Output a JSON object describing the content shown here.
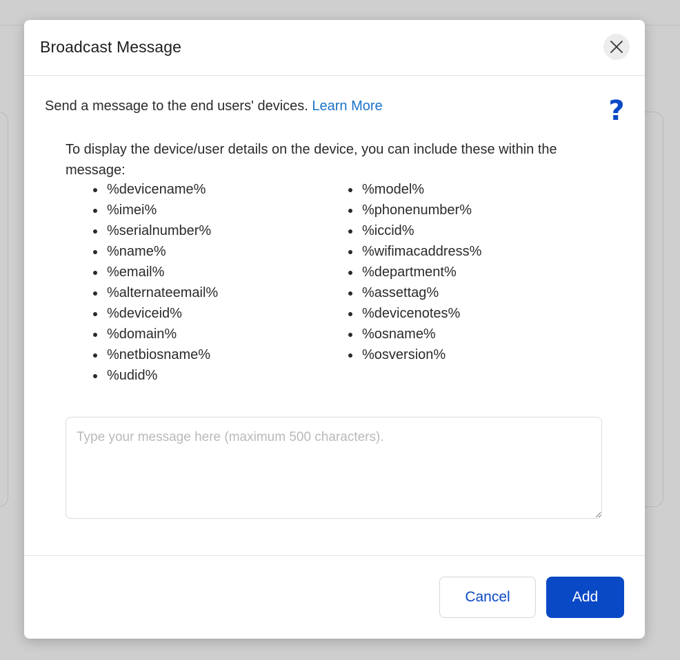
{
  "dialog": {
    "title": "Broadcast Message",
    "intro_text": "Send a message to the end users' devices.",
    "learn_more": "Learn More",
    "help_glyph": "?",
    "info_text": "To display the device/user details on the device, you can include these within the message:",
    "variables_col1": [
      "%devicename%",
      "%imei%",
      "%serialnumber%",
      "%name%",
      "%email%",
      "%alternateemail%",
      "%deviceid%",
      "%domain%",
      "%netbiosname%",
      "%udid%"
    ],
    "variables_col2": [
      "%model%",
      "%phonenumber%",
      "%iccid%",
      "%wifimacaddress%",
      "%department%",
      "%assettag%",
      "%devicenotes%",
      "%osname%",
      "%osversion%"
    ],
    "message_placeholder": "Type your message here (maximum 500 characters).",
    "message_value": "",
    "cancel_label": "Cancel",
    "add_label": "Add"
  },
  "icons": {
    "close": "close-icon",
    "help": "help-icon"
  },
  "colors": {
    "accent": "#0a49c6",
    "link": "#1a73c8",
    "backdrop": "#cfcfcf"
  }
}
